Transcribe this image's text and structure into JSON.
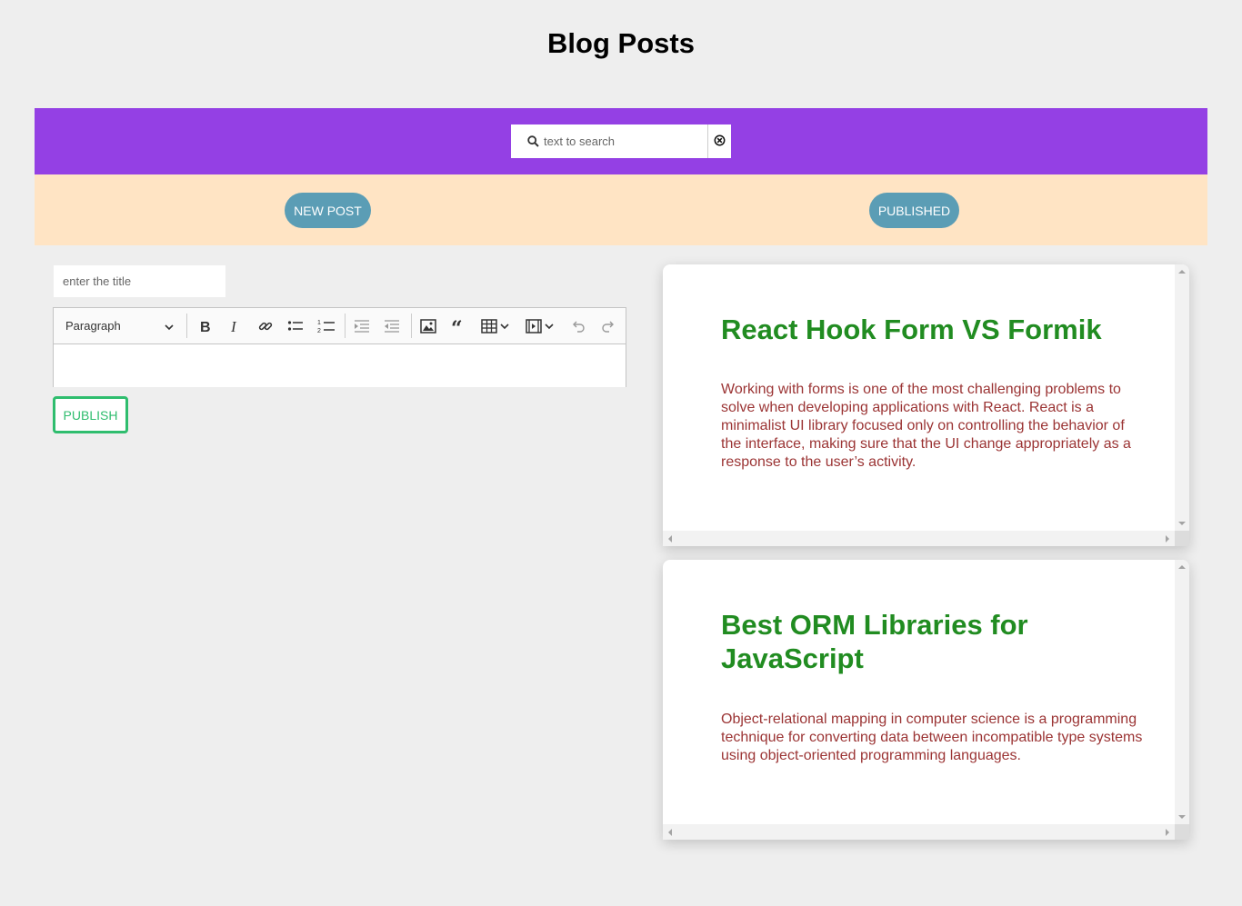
{
  "page": {
    "title": "Blog Posts"
  },
  "search": {
    "placeholder": "text to search",
    "value": ""
  },
  "nav": {
    "new_post_label": "NEW POST",
    "published_label": "PUBLISHED"
  },
  "editor": {
    "title_placeholder": "enter the title",
    "block_format": "Paragraph",
    "toolbar_icons": [
      "bold-icon",
      "italic-icon",
      "link-icon",
      "bulleted-list-icon",
      "numbered-list-icon",
      "outdent-icon",
      "indent-icon",
      "image-icon",
      "quote-icon",
      "table-icon",
      "media-icon",
      "undo-icon",
      "redo-icon"
    ],
    "publish_label": "PUBLISH"
  },
  "posts": [
    {
      "title": "React Hook Form VS Formik",
      "body": "Working with forms is one of the most challenging problems to solve when developing applications with React. React is a minimalist UI library focused only on controlling the behavior of the interface, making sure that the UI change appropriately as a response to the user’s activity."
    },
    {
      "title": "Best ORM Libraries for JavaScript",
      "body": "Object-relational mapping in computer science is a programming technique for converting data between incompatible type systems using object-oriented programming languages."
    }
  ],
  "colors": {
    "search_bar": "#9440e4",
    "nav_bar": "#ffe4c4",
    "pill": "#5b9db5",
    "publish": "#2fbd6e",
    "post_title": "#218c21",
    "post_body": "#9b3434"
  }
}
